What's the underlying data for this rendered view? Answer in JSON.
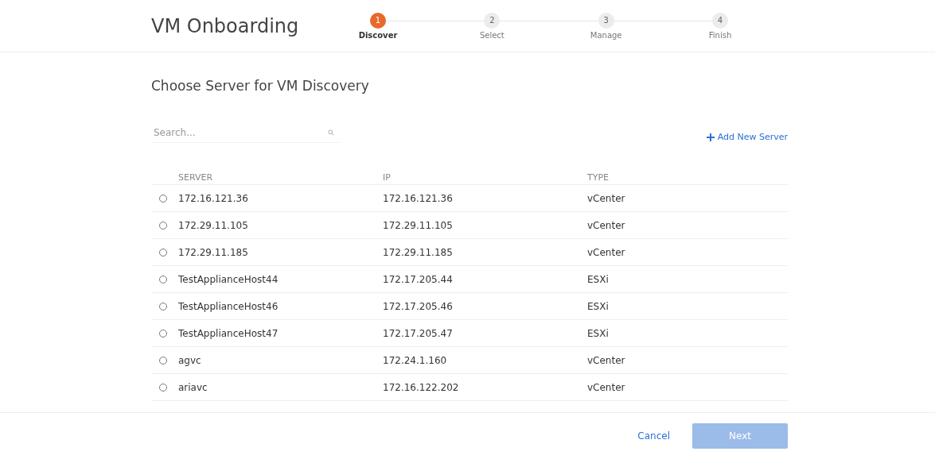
{
  "header": {
    "title": "VM Onboarding"
  },
  "steps": [
    {
      "number": "1",
      "label": "Discover",
      "selected": true
    },
    {
      "number": "2",
      "label": "Select",
      "selected": false
    },
    {
      "number": "3",
      "label": "Manage",
      "selected": false
    },
    {
      "number": "4",
      "label": "Finish",
      "selected": false
    }
  ],
  "heading": "Choose Server for VM Discovery",
  "search": {
    "placeholder": "Search..."
  },
  "add_link": "Add New Server",
  "table": {
    "columns": [
      "SERVER",
      "IP",
      "TYPE"
    ],
    "rows": [
      {
        "server": "172.16.121.36",
        "ip": "172.16.121.36",
        "type": "vCenter",
        "selected": false
      },
      {
        "server": "172.29.11.105",
        "ip": "172.29.11.105",
        "type": "vCenter",
        "selected": false
      },
      {
        "server": "172.29.11.185",
        "ip": "172.29.11.185",
        "type": "vCenter",
        "selected": false
      },
      {
        "server": "TestApplianceHost44",
        "ip": "172.17.205.44",
        "type": "ESXi",
        "selected": false
      },
      {
        "server": "TestApplianceHost46",
        "ip": "172.17.205.46",
        "type": "ESXi",
        "selected": false
      },
      {
        "server": "TestApplianceHost47",
        "ip": "172.17.205.47",
        "type": "ESXi",
        "selected": false
      },
      {
        "server": "agvc",
        "ip": "172.24.1.160",
        "type": "vCenter",
        "selected": false
      },
      {
        "server": "ariavc",
        "ip": "172.16.122.202",
        "type": "vCenter",
        "selected": false
      }
    ]
  },
  "footer": {
    "cancel": "Cancel",
    "next": {
      "label": "Next",
      "disabled": true
    }
  }
}
